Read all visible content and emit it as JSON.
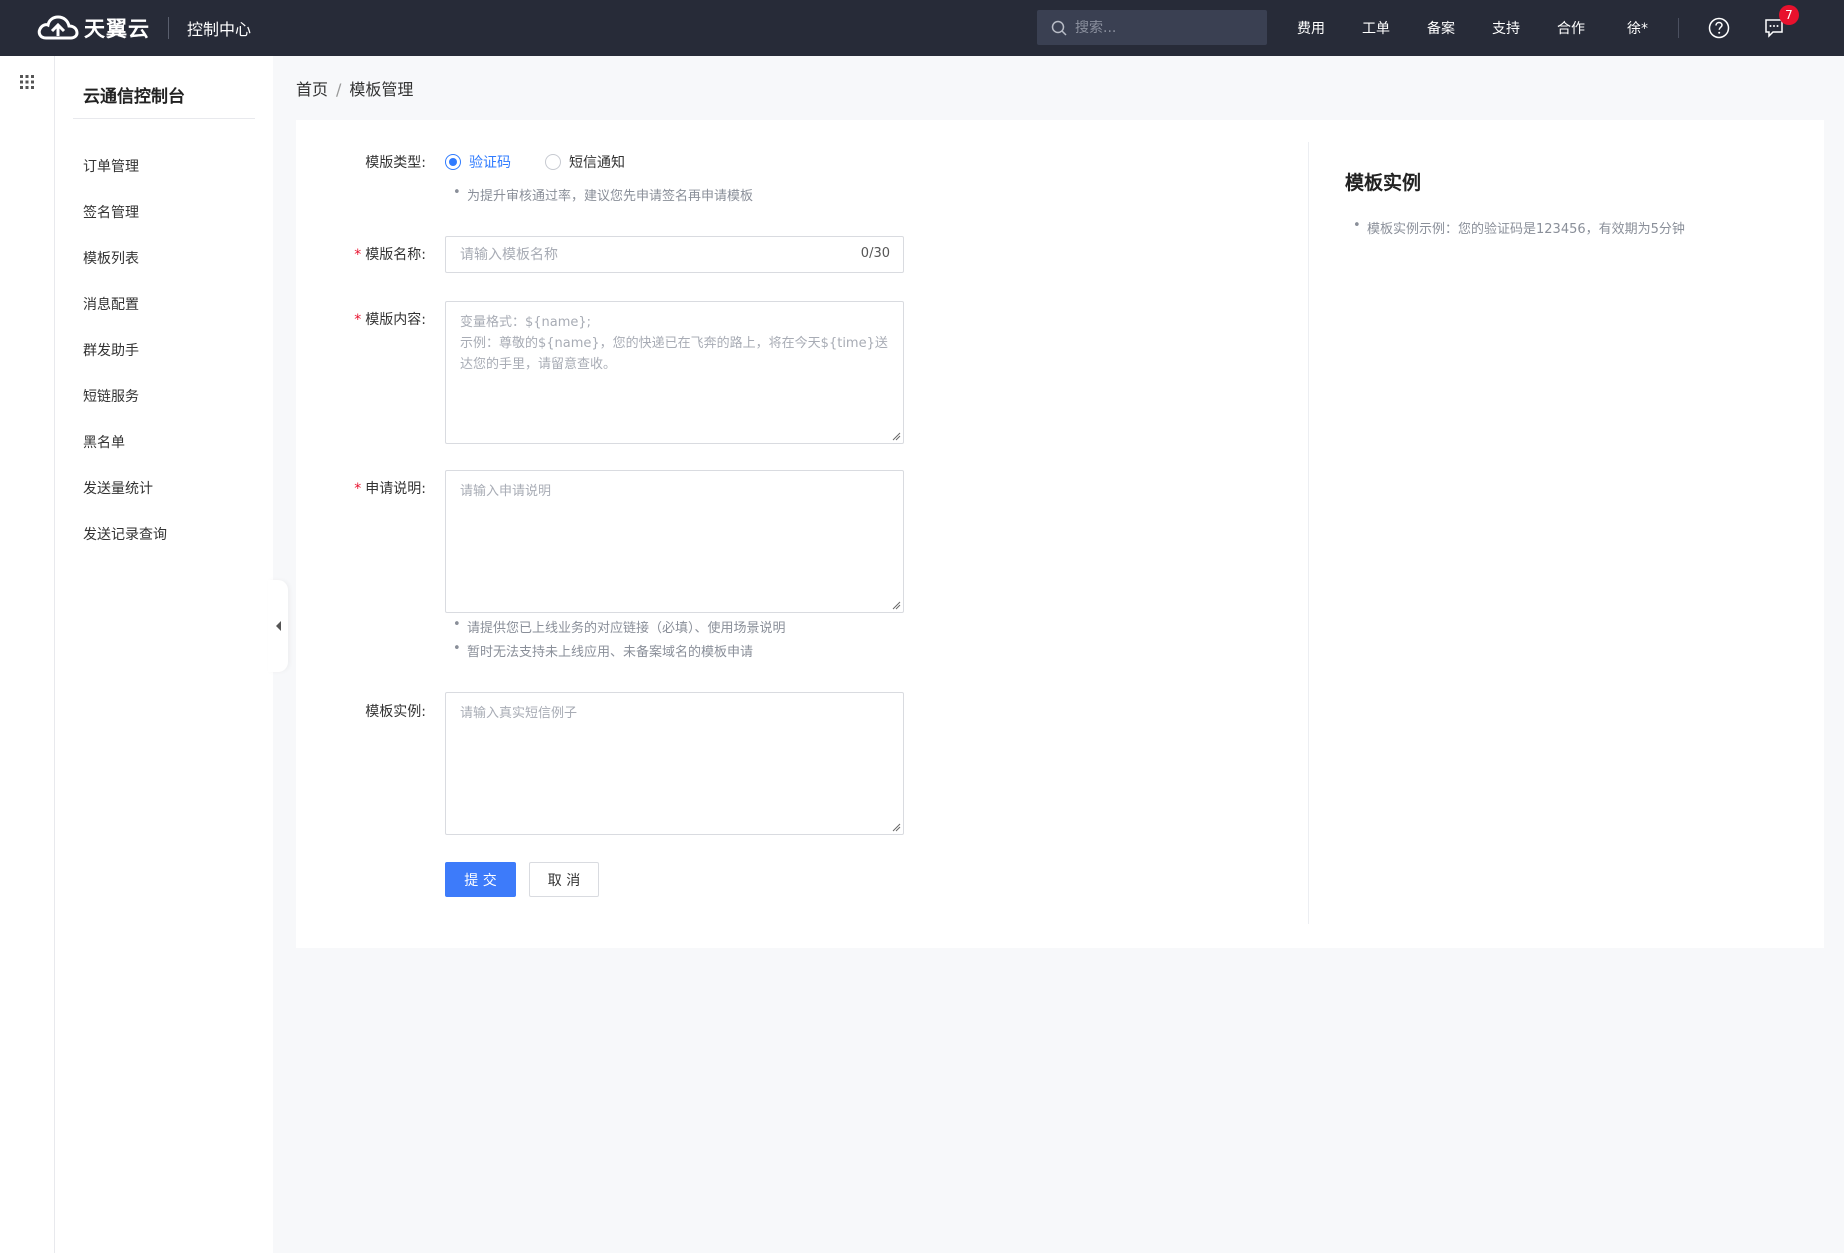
{
  "header": {
    "brand": "天翼云",
    "console_title": "控制中心",
    "search_placeholder": "搜索...",
    "nav": [
      "费用",
      "工单",
      "备案",
      "支持",
      "合作"
    ],
    "user": "徐*",
    "message_count": "7"
  },
  "sidebar": {
    "title": "云通信控制台",
    "items": [
      "订单管理",
      "签名管理",
      "模板列表",
      "消息配置",
      "群发助手",
      "短链服务",
      "黑名单",
      "发送量统计",
      "发送记录查询"
    ]
  },
  "breadcrumb": {
    "home": "首页",
    "separator": "/",
    "current": "模板管理"
  },
  "form": {
    "type_label": "模版类型:",
    "type_options": [
      {
        "label": "验证码",
        "checked": true
      },
      {
        "label": "短信通知",
        "checked": false
      }
    ],
    "type_hint": "为提升审核通过率，建议您先申请签名再申请模板",
    "required_mark": "*",
    "name_label": "模版名称:",
    "name_placeholder": "请输入模板名称",
    "name_counter": "0/30",
    "content_label": "模版内容:",
    "content_placeholder": "变量格式：${name};\n示例：尊敬的${name}，您的快递已在飞奔的路上，将在今天${time}送达您的手里，请留意查收。",
    "desc_label": "申请说明:",
    "desc_placeholder": "请输入申请说明",
    "desc_hints": [
      "请提供您已上线业务的对应链接（必填）、使用场景说明",
      "暂时无法支持未上线应用、未备案域名的模板申请"
    ],
    "sample_label": "模板实例:",
    "sample_placeholder": "请输入真实短信例子",
    "submit_label": "提 交",
    "cancel_label": "取 消"
  },
  "example_panel": {
    "title": "模板实例",
    "text": "模板实例示例：您的验证码是123456，有效期为5分钟"
  },
  "colors": {
    "topbar": "#272b38",
    "primary": "#3d7bfa",
    "required": "#e8112d"
  }
}
